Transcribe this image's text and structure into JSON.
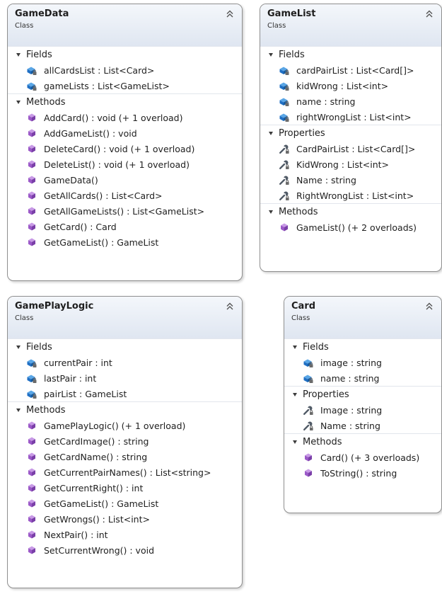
{
  "classes": [
    {
      "id": "gamedata",
      "name": "GameData",
      "type": "Class",
      "sections": [
        {
          "title": "Fields",
          "kind": "field",
          "items": [
            "allCardsList : List<Card>",
            "gameLists : List<GameList>"
          ]
        },
        {
          "title": "Methods",
          "kind": "method",
          "items": [
            "AddCard() : void (+ 1 overload)",
            "AddGameList() : void",
            "DeleteCard() : void (+ 1 overload)",
            "DeleteList() : void (+ 1 overload)",
            "GameData()",
            "GetAllCards() : List<Card>",
            "GetAllGameLists() : List<GameList>",
            "GetCard() : Card",
            "GetGameList() : GameList"
          ]
        }
      ]
    },
    {
      "id": "gamelist",
      "name": "GameList",
      "type": "Class",
      "sections": [
        {
          "title": "Fields",
          "kind": "field",
          "items": [
            "cardPairList : List<Card[]>",
            "kidWrong : List<int>",
            "name : string",
            "rightWrongList : List<int>"
          ]
        },
        {
          "title": "Properties",
          "kind": "property",
          "items": [
            "CardPairList : List<Card[]>",
            "KidWrong : List<int>",
            "Name : string",
            "RightWrongList : List<int>"
          ]
        },
        {
          "title": "Methods",
          "kind": "method",
          "items": [
            "GameList() (+ 2 overloads)"
          ]
        }
      ]
    },
    {
      "id": "gameplaylogic",
      "name": "GamePlayLogic",
      "type": "Class",
      "sections": [
        {
          "title": "Fields",
          "kind": "field",
          "items": [
            "currentPair : int",
            "lastPair : int",
            "pairList : GameList"
          ]
        },
        {
          "title": "Methods",
          "kind": "method",
          "items": [
            "GamePlayLogic() (+ 1 overload)",
            "GetCardImage() : string",
            "GetCardName() : string",
            "GetCurrentPairNames() : List<string>",
            "GetCurrentRight() : int",
            "GetGameList() : GameList",
            "GetWrongs() : List<int>",
            "NextPair() : int",
            "SetCurrentWrong() : void"
          ]
        }
      ]
    },
    {
      "id": "card",
      "name": "Card",
      "type": "Class",
      "sections": [
        {
          "title": "Fields",
          "kind": "field",
          "items": [
            "image : string",
            "name : string"
          ]
        },
        {
          "title": "Properties",
          "kind": "property",
          "items": [
            "Image : string",
            "Name : string"
          ]
        },
        {
          "title": "Methods",
          "kind": "method",
          "items": [
            "Card() (+ 3 overloads)",
            "ToString() : string"
          ]
        }
      ]
    }
  ],
  "icons": {
    "collapse": "double-chevron-up-icon",
    "section": "expanded-triangle-icon",
    "field": "private-field-icon",
    "property": "wrench-property-icon",
    "method": "method-cube-icon"
  },
  "colors": {
    "header_top": "#f4f7fb",
    "header_bottom": "#dfe6f1",
    "border": "#8f8f8f",
    "field_blue": "#1f6fc4",
    "method_purple": "#9b59c8",
    "wrench_gray": "#505a66"
  }
}
